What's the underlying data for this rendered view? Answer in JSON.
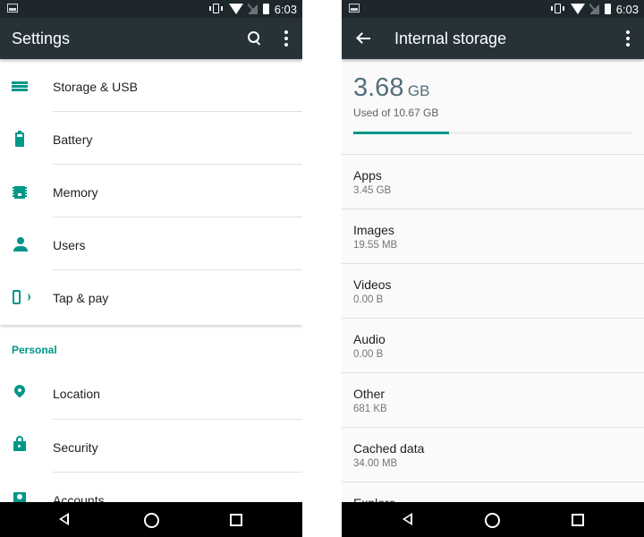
{
  "status_bar": {
    "time": "6:03"
  },
  "settings_screen": {
    "title": "Settings",
    "device_items": [
      {
        "label": "Storage & USB",
        "icon": "storage-icon"
      },
      {
        "label": "Battery",
        "icon": "battery-icon"
      },
      {
        "label": "Memory",
        "icon": "memory-icon"
      },
      {
        "label": "Users",
        "icon": "person-icon"
      },
      {
        "label": "Tap & pay",
        "icon": "tap-pay-icon"
      }
    ],
    "section_personal": "Personal",
    "personal_items": [
      {
        "label": "Location",
        "icon": "location-icon"
      },
      {
        "label": "Security",
        "icon": "lock-icon"
      },
      {
        "label": "Accounts",
        "icon": "account-icon"
      }
    ]
  },
  "storage_screen": {
    "title": "Internal storage",
    "used_amount": "3.68",
    "used_unit": "GB",
    "used_of": "Used of 10.67 GB",
    "used_fraction": 0.345,
    "accent": "#009688",
    "items": [
      {
        "label": "Apps",
        "value": "3.45 GB"
      },
      {
        "label": "Images",
        "value": "19.55 MB"
      },
      {
        "label": "Videos",
        "value": "0.00 B"
      },
      {
        "label": "Audio",
        "value": "0.00 B"
      },
      {
        "label": "Other",
        "value": "681 KB"
      },
      {
        "label": "Cached data",
        "value": "34.00 MB"
      },
      {
        "label": "Explore",
        "value": ""
      }
    ]
  }
}
